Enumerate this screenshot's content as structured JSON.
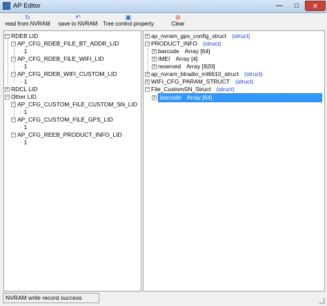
{
  "window": {
    "title": "AP Editor",
    "min_symbol": "—",
    "max_symbol": "□",
    "close_symbol": "✕"
  },
  "toolbar": {
    "read_label": "read from NVRAM",
    "save_label": "save to NVRAM",
    "tree_label": "Tree control property",
    "clear_label": "Clear",
    "icons": {
      "read": "refresh-icon",
      "save": "undo-icon",
      "tree": "tree-window-icon",
      "clear": "stop-icon"
    }
  },
  "left_tree": {
    "items": [
      {
        "label": "RDEB LID",
        "value": ""
      },
      {
        "label": "AP_CFG_RDEB_FILE_BT_ADDR_LID",
        "value": "1"
      },
      {
        "label": "AP_CFG_RDEB_FILE_WIFI_LID",
        "value": "1"
      },
      {
        "label": "AP_CFG_RDEB_WIFI_CUSTOM_LID",
        "value": "1"
      },
      {
        "label": "RDCL LID",
        "value": ""
      },
      {
        "label": "Other LID",
        "value": ""
      },
      {
        "label": "AP_CFG_CUSTOM_FILE_CUSTOM_SN_LID",
        "value": "1"
      },
      {
        "label": "AP_CFG_CUSTOM_FILE_GPS_LID",
        "value": "1"
      },
      {
        "label": "AP_CFG_REEB_PRODUCT_INFO_LID",
        "value": "1"
      }
    ]
  },
  "right_tree": {
    "items": [
      {
        "name": "ap_nvram_gps_config_struct",
        "type": "(struct)"
      },
      {
        "name": "PRODUCT_INFO",
        "type": "(struct)"
      },
      {
        "name": "barcode",
        "type": "Array [64]"
      },
      {
        "name": "IMEI",
        "type": "Array [4]"
      },
      {
        "name": "reserved",
        "type": "Array [920]"
      },
      {
        "name": "ap_nvram_btradio_mt6610_struct",
        "type": "(struct)"
      },
      {
        "name": "WIFI_CFG_PARAM_STRUCT",
        "type": "(struct)"
      },
      {
        "name": "File_CustomSN_Struct",
        "type": "(struct)"
      },
      {
        "name": "barcode",
        "type": "Array [64]"
      }
    ]
  },
  "status": {
    "text": "NVRAM write record success"
  },
  "colors": {
    "struct": "#1b38c8",
    "selection": "#3399ff",
    "close": "#c7443a"
  }
}
